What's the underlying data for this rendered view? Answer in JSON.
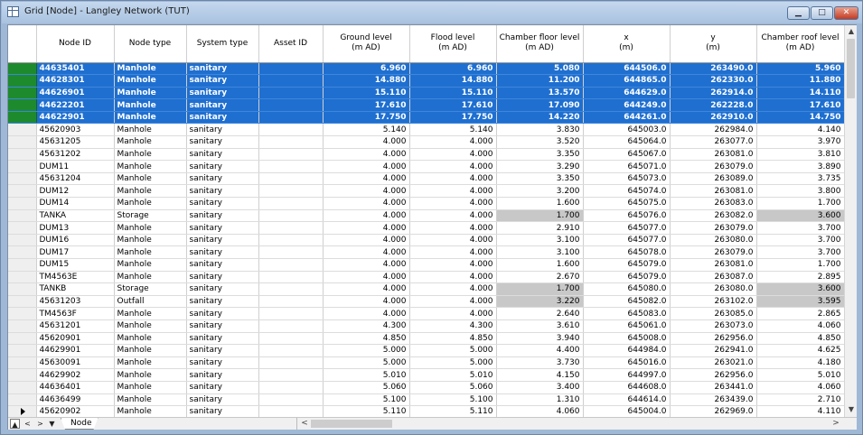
{
  "window": {
    "title": "Grid [Node] - Langley Network (TUT)",
    "buttons": {
      "min": "▁",
      "max": "□",
      "close": "✕"
    }
  },
  "columns": [
    {
      "label": "Node ID",
      "unit": ""
    },
    {
      "label": "Node type",
      "unit": ""
    },
    {
      "label": "System type",
      "unit": ""
    },
    {
      "label": "Asset ID",
      "unit": ""
    },
    {
      "label": "Ground level",
      "unit": "(m AD)"
    },
    {
      "label": "Flood level",
      "unit": "(m AD)"
    },
    {
      "label": "Chamber floor level",
      "unit": "(m AD)"
    },
    {
      "label": "x",
      "unit": "(m)"
    },
    {
      "label": "y",
      "unit": "(m)"
    },
    {
      "label": "Chamber roof level",
      "unit": "(m AD)"
    }
  ],
  "rows": [
    {
      "id": "44635401",
      "type": "Manhole",
      "system": "sanitary",
      "asset": "",
      "ground": "6.960",
      "flood": "6.960",
      "floor": "5.080",
      "x": "644506.0",
      "y": "263490.0",
      "roof": "5.960",
      "selected": true
    },
    {
      "id": "44628301",
      "type": "Manhole",
      "system": "sanitary",
      "asset": "",
      "ground": "14.880",
      "flood": "14.880",
      "floor": "11.200",
      "x": "644865.0",
      "y": "262330.0",
      "roof": "11.880",
      "selected": true
    },
    {
      "id": "44626901",
      "type": "Manhole",
      "system": "sanitary",
      "asset": "",
      "ground": "15.110",
      "flood": "15.110",
      "floor": "13.570",
      "x": "644629.0",
      "y": "262914.0",
      "roof": "14.110",
      "selected": true
    },
    {
      "id": "44622201",
      "type": "Manhole",
      "system": "sanitary",
      "asset": "",
      "ground": "17.610",
      "flood": "17.610",
      "floor": "17.090",
      "x": "644249.0",
      "y": "262228.0",
      "roof": "17.610",
      "selected": true
    },
    {
      "id": "44622901",
      "type": "Manhole",
      "system": "sanitary",
      "asset": "",
      "ground": "17.750",
      "flood": "17.750",
      "floor": "14.220",
      "x": "644261.0",
      "y": "262910.0",
      "roof": "14.750",
      "selected": true
    },
    {
      "id": "45620903",
      "type": "Manhole",
      "system": "sanitary",
      "asset": "",
      "ground": "5.140",
      "flood": "5.140",
      "floor": "3.830",
      "x": "645003.0",
      "y": "262984.0",
      "roof": "4.140"
    },
    {
      "id": "45631205",
      "type": "Manhole",
      "system": "sanitary",
      "asset": "",
      "ground": "4.000",
      "flood": "4.000",
      "floor": "3.520",
      "x": "645064.0",
      "y": "263077.0",
      "roof": "3.970"
    },
    {
      "id": "45631202",
      "type": "Manhole",
      "system": "sanitary",
      "asset": "",
      "ground": "4.000",
      "flood": "4.000",
      "floor": "3.350",
      "x": "645067.0",
      "y": "263081.0",
      "roof": "3.810"
    },
    {
      "id": "DUM11",
      "type": "Manhole",
      "system": "sanitary",
      "asset": "",
      "ground": "4.000",
      "flood": "4.000",
      "floor": "3.290",
      "x": "645071.0",
      "y": "263079.0",
      "roof": "3.890"
    },
    {
      "id": "45631204",
      "type": "Manhole",
      "system": "sanitary",
      "asset": "",
      "ground": "4.000",
      "flood": "4.000",
      "floor": "3.350",
      "x": "645073.0",
      "y": "263089.0",
      "roof": "3.735"
    },
    {
      "id": "DUM12",
      "type": "Manhole",
      "system": "sanitary",
      "asset": "",
      "ground": "4.000",
      "flood": "4.000",
      "floor": "3.200",
      "x": "645074.0",
      "y": "263081.0",
      "roof": "3.800"
    },
    {
      "id": "DUM14",
      "type": "Manhole",
      "system": "sanitary",
      "asset": "",
      "ground": "4.000",
      "flood": "4.000",
      "floor": "1.600",
      "x": "645075.0",
      "y": "263083.0",
      "roof": "1.700"
    },
    {
      "id": "TANKA",
      "type": "Storage",
      "system": "sanitary",
      "asset": "",
      "ground": "4.000",
      "flood": "4.000",
      "floor": "1.700",
      "x": "645076.0",
      "y": "263082.0",
      "roof": "3.600",
      "gray": true
    },
    {
      "id": "DUM13",
      "type": "Manhole",
      "system": "sanitary",
      "asset": "",
      "ground": "4.000",
      "flood": "4.000",
      "floor": "2.910",
      "x": "645077.0",
      "y": "263079.0",
      "roof": "3.700"
    },
    {
      "id": "DUM16",
      "type": "Manhole",
      "system": "sanitary",
      "asset": "",
      "ground": "4.000",
      "flood": "4.000",
      "floor": "3.100",
      "x": "645077.0",
      "y": "263080.0",
      "roof": "3.700"
    },
    {
      "id": "DUM17",
      "type": "Manhole",
      "system": "sanitary",
      "asset": "",
      "ground": "4.000",
      "flood": "4.000",
      "floor": "3.100",
      "x": "645078.0",
      "y": "263079.0",
      "roof": "3.700"
    },
    {
      "id": "DUM15",
      "type": "Manhole",
      "system": "sanitary",
      "asset": "",
      "ground": "4.000",
      "flood": "4.000",
      "floor": "1.600",
      "x": "645079.0",
      "y": "263081.0",
      "roof": "1.700"
    },
    {
      "id": "TM4563E",
      "type": "Manhole",
      "system": "sanitary",
      "asset": "",
      "ground": "4.000",
      "flood": "4.000",
      "floor": "2.670",
      "x": "645079.0",
      "y": "263087.0",
      "roof": "2.895"
    },
    {
      "id": "TANKB",
      "type": "Storage",
      "system": "sanitary",
      "asset": "",
      "ground": "4.000",
      "flood": "4.000",
      "floor": "1.700",
      "x": "645080.0",
      "y": "263080.0",
      "roof": "3.600",
      "gray": true
    },
    {
      "id": "45631203",
      "type": "Outfall",
      "system": "sanitary",
      "asset": "",
      "ground": "4.000",
      "flood": "4.000",
      "floor": "3.220",
      "x": "645082.0",
      "y": "263102.0",
      "roof": "3.595",
      "gray": true
    },
    {
      "id": "TM4563F",
      "type": "Manhole",
      "system": "sanitary",
      "asset": "",
      "ground": "4.000",
      "flood": "4.000",
      "floor": "2.640",
      "x": "645083.0",
      "y": "263085.0",
      "roof": "2.865"
    },
    {
      "id": "45631201",
      "type": "Manhole",
      "system": "sanitary",
      "asset": "",
      "ground": "4.300",
      "flood": "4.300",
      "floor": "3.610",
      "x": "645061.0",
      "y": "263073.0",
      "roof": "4.060"
    },
    {
      "id": "45620901",
      "type": "Manhole",
      "system": "sanitary",
      "asset": "",
      "ground": "4.850",
      "flood": "4.850",
      "floor": "3.940",
      "x": "645008.0",
      "y": "262956.0",
      "roof": "4.850"
    },
    {
      "id": "44629901",
      "type": "Manhole",
      "system": "sanitary",
      "asset": "",
      "ground": "5.000",
      "flood": "5.000",
      "floor": "4.400",
      "x": "644984.0",
      "y": "262941.0",
      "roof": "4.625"
    },
    {
      "id": "45630091",
      "type": "Manhole",
      "system": "sanitary",
      "asset": "",
      "ground": "5.000",
      "flood": "5.000",
      "floor": "3.730",
      "x": "645016.0",
      "y": "263021.0",
      "roof": "4.180"
    },
    {
      "id": "44629902",
      "type": "Manhole",
      "system": "sanitary",
      "asset": "",
      "ground": "5.010",
      "flood": "5.010",
      "floor": "4.150",
      "x": "644997.0",
      "y": "262956.0",
      "roof": "5.010"
    },
    {
      "id": "44636401",
      "type": "Manhole",
      "system": "sanitary",
      "asset": "",
      "ground": "5.060",
      "flood": "5.060",
      "floor": "3.400",
      "x": "644608.0",
      "y": "263441.0",
      "roof": "4.060"
    },
    {
      "id": "44636499",
      "type": "Manhole",
      "system": "sanitary",
      "asset": "",
      "ground": "5.100",
      "flood": "5.100",
      "floor": "1.310",
      "x": "644614.0",
      "y": "263439.0",
      "roof": "2.710"
    },
    {
      "id": "45620902",
      "type": "Manhole",
      "system": "sanitary",
      "asset": "",
      "ground": "5.110",
      "flood": "5.110",
      "floor": "4.060",
      "x": "645004.0",
      "y": "262969.0",
      "roof": "4.110",
      "current": true
    }
  ],
  "tabs": [
    {
      "label": "Node"
    }
  ],
  "nav": {
    "first": "▲",
    "prev": "<",
    "next": ">",
    "last": "▼"
  },
  "scroll": {
    "up": "▲",
    "down": "▼",
    "left": "<",
    "right": ">"
  }
}
